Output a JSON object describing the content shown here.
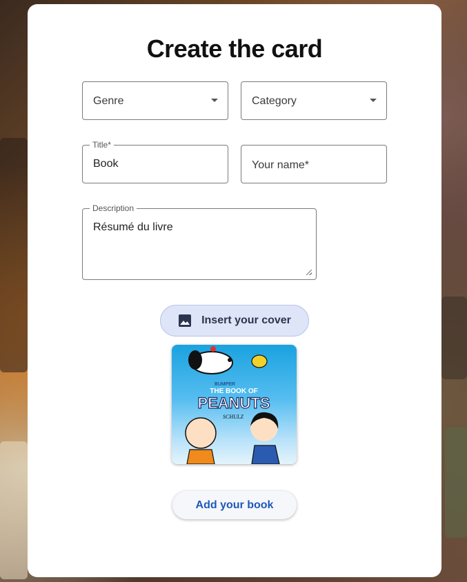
{
  "page": {
    "title": "Create the card"
  },
  "form": {
    "genre": {
      "placeholder": "Genre"
    },
    "category": {
      "placeholder": "Category"
    },
    "title": {
      "label": "Title*",
      "value": "Book"
    },
    "author": {
      "placeholder": "Your name*"
    },
    "description": {
      "label": "Description",
      "value": "Résumé du livre"
    }
  },
  "cover": {
    "button_label": "Insert your cover",
    "button_icon": "image-icon",
    "image": {
      "title_small": "BUMPER",
      "title_line1": "THE BOOK OF",
      "title_main": "PEANUTS",
      "signature": "SCHULZ"
    }
  },
  "actions": {
    "add_label": "Add your book"
  },
  "colors": {
    "accent_button_bg": "#dfe5f8",
    "accent_text": "#1e58b8",
    "cover_sky": "#1aa2e0"
  }
}
